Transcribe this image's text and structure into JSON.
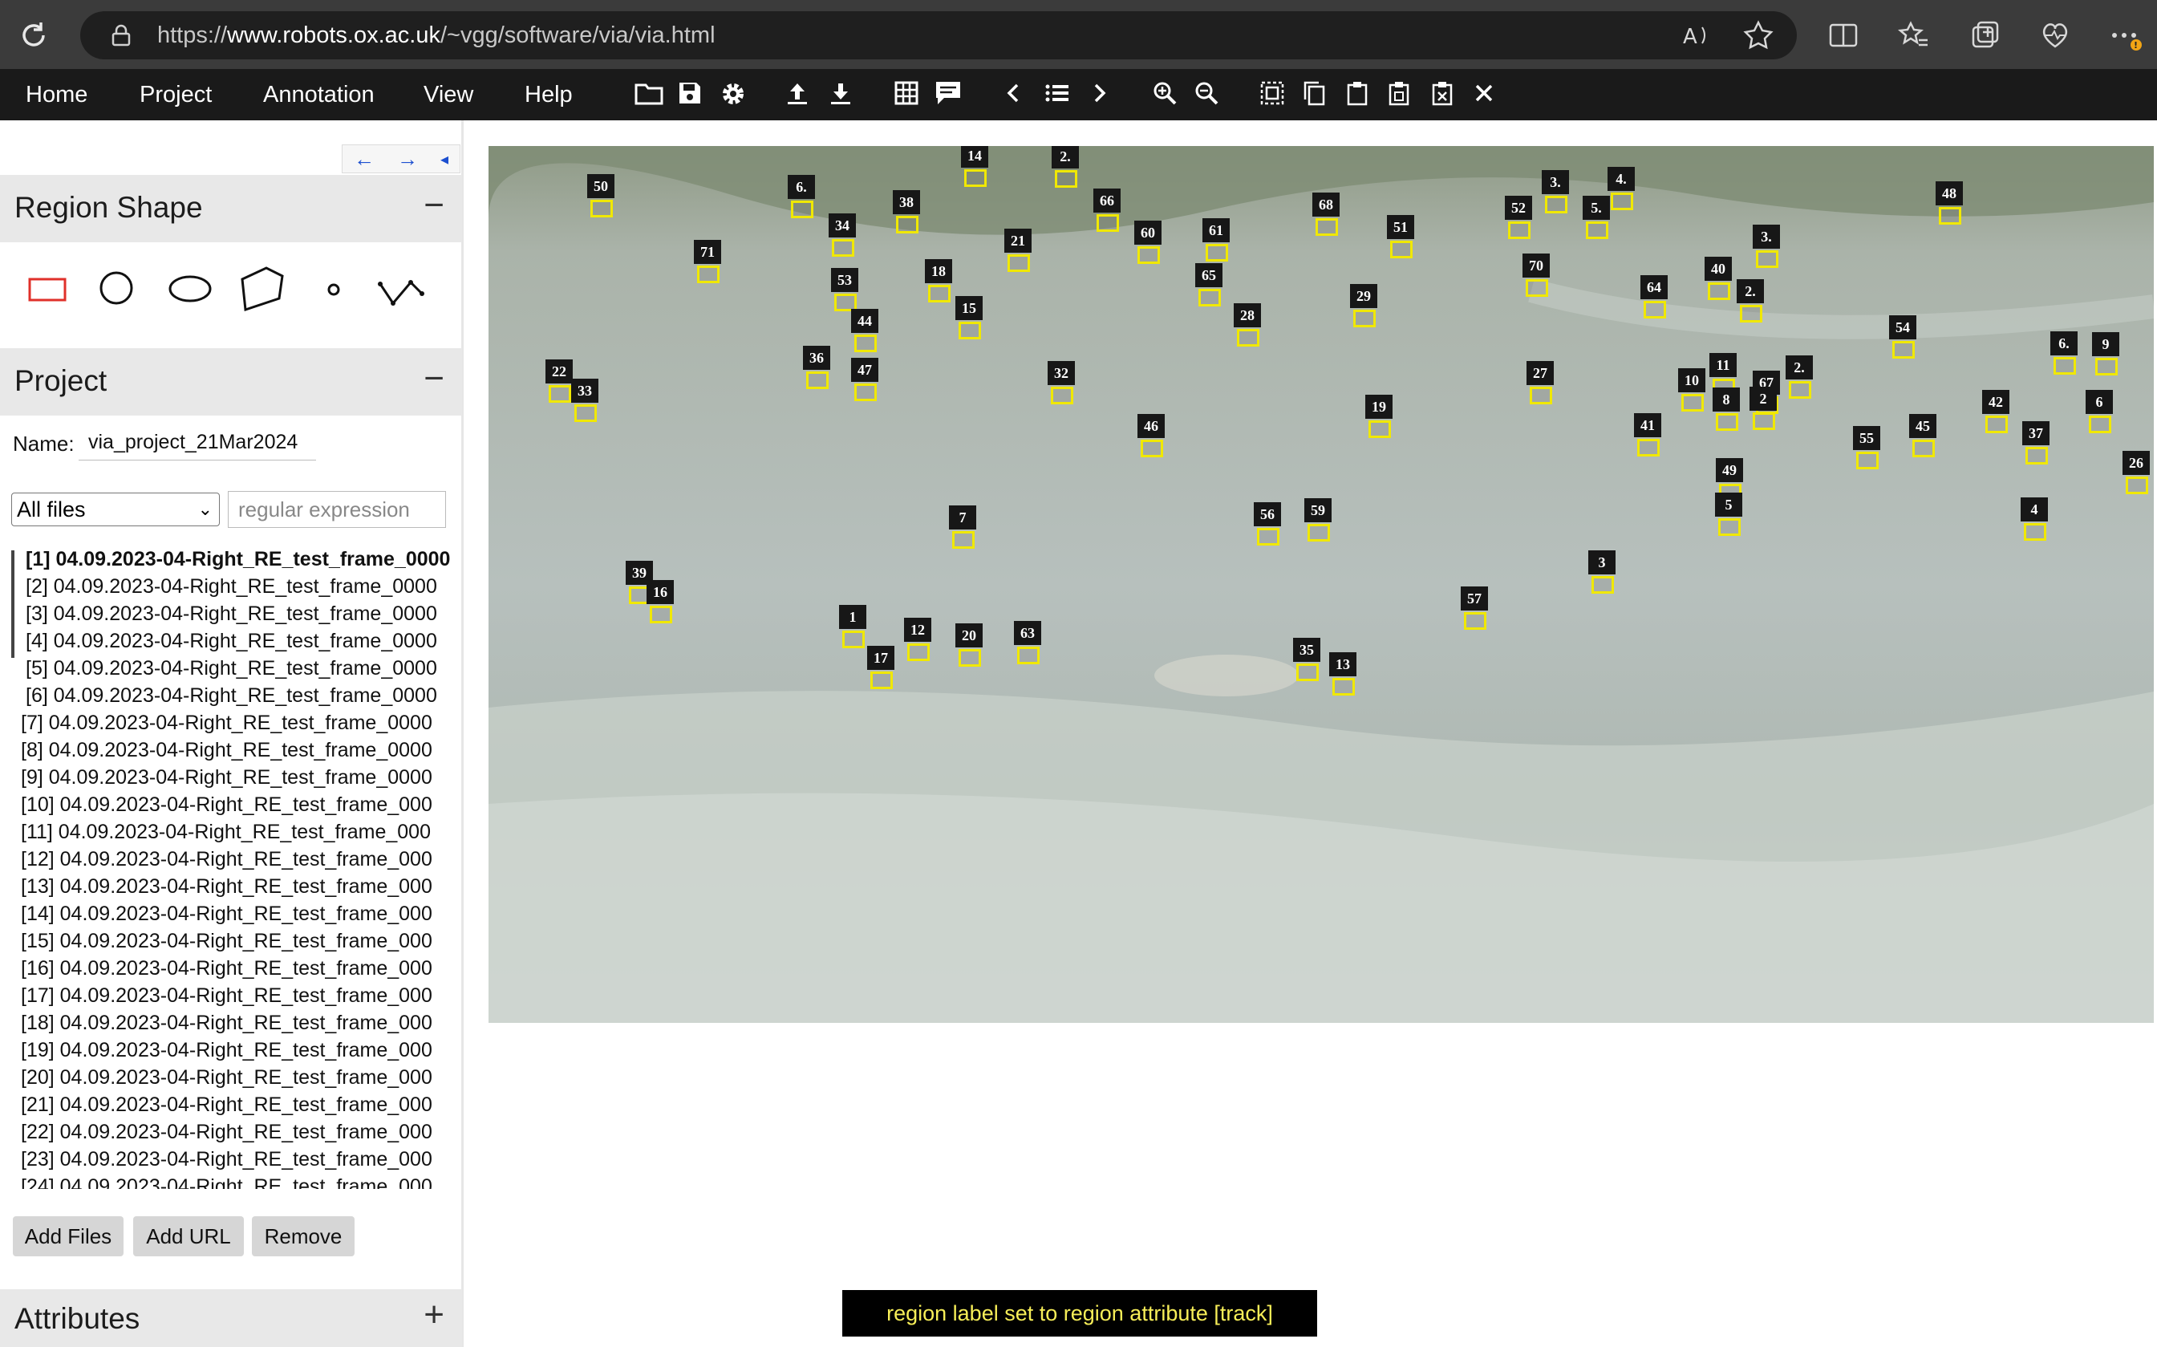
{
  "browser": {
    "url_prefix": "https://",
    "url_host": "www.robots.ox.ac.uk",
    "url_path": "/~vgg/software/via/via.html"
  },
  "menu": {
    "items": [
      "Home",
      "Project",
      "Annotation",
      "View",
      "Help"
    ]
  },
  "nav": {
    "prev": "←",
    "next": "→",
    "collapse": "◂"
  },
  "region_shape": {
    "title": "Region Shape",
    "toggle": "−"
  },
  "project": {
    "title": "Project",
    "toggle": "−",
    "name_label": "Name:",
    "name_value": "via_project_21Mar2024",
    "filter_selected": "All files",
    "regex_placeholder": "regular expression"
  },
  "files": [
    "[1] 04.09.2023-04-Right_RE_test_frame_0000",
    "[2] 04.09.2023-04-Right_RE_test_frame_0000",
    "[3] 04.09.2023-04-Right_RE_test_frame_0000",
    "[4] 04.09.2023-04-Right_RE_test_frame_0000",
    "[5] 04.09.2023-04-Right_RE_test_frame_0000",
    "[6] 04.09.2023-04-Right_RE_test_frame_0000",
    "[7] 04.09.2023-04-Right_RE_test_frame_0000",
    "[8] 04.09.2023-04-Right_RE_test_frame_0000",
    "[9] 04.09.2023-04-Right_RE_test_frame_0000",
    "[10] 04.09.2023-04-Right_RE_test_frame_000",
    "[11] 04.09.2023-04-Right_RE_test_frame_000",
    "[12] 04.09.2023-04-Right_RE_test_frame_000",
    "[13] 04.09.2023-04-Right_RE_test_frame_000",
    "[14] 04.09.2023-04-Right_RE_test_frame_000",
    "[15] 04.09.2023-04-Right_RE_test_frame_000",
    "[16] 04.09.2023-04-Right_RE_test_frame_000",
    "[17] 04.09.2023-04-Right_RE_test_frame_000",
    "[18] 04.09.2023-04-Right_RE_test_frame_000",
    "[19] 04.09.2023-04-Right_RE_test_frame_000",
    "[20] 04.09.2023-04-Right_RE_test_frame_000",
    "[21] 04.09.2023-04-Right_RE_test_frame_000",
    "[22] 04.09.2023-04-Right_RE_test_frame_000",
    "[23] 04.09.2023-04-Right_RE_test_frame_000",
    "[24] 04.09.2023-04-Right_RE_test_frame_000"
  ],
  "buttons": {
    "add_files": "Add Files",
    "add_url": "Add URL",
    "remove": "Remove"
  },
  "attributes": {
    "title": "Attributes",
    "toggle": "+"
  },
  "status": "region label set to region attribute [track]",
  "regions": [
    "50",
    "6.",
    "38",
    "14",
    "2.",
    "66",
    "34",
    "71",
    "21",
    "60",
    "61",
    "68",
    "51",
    "52",
    "3.",
    "4.",
    "5.",
    "48",
    "3.",
    "53",
    "18",
    "65",
    "70",
    "40",
    "64",
    "2.",
    "29",
    "44",
    "15",
    "28",
    "54",
    "6.",
    "9",
    "36",
    "47",
    "22",
    "33",
    "32",
    "27",
    "11",
    "10",
    "67",
    "2.",
    "8",
    "2",
    "19",
    "46",
    "41",
    "42",
    "6",
    "45",
    "55",
    "37",
    "49",
    "26",
    "5",
    "7",
    "56",
    "59",
    "4",
    "3",
    "39",
    "16",
    "57",
    "1",
    "12",
    "20",
    "63",
    "35",
    "17",
    "13"
  ],
  "colors": {
    "region_border": "#f0e800",
    "status_text": "#f7ee58",
    "shape_selected": "#e0302a"
  }
}
